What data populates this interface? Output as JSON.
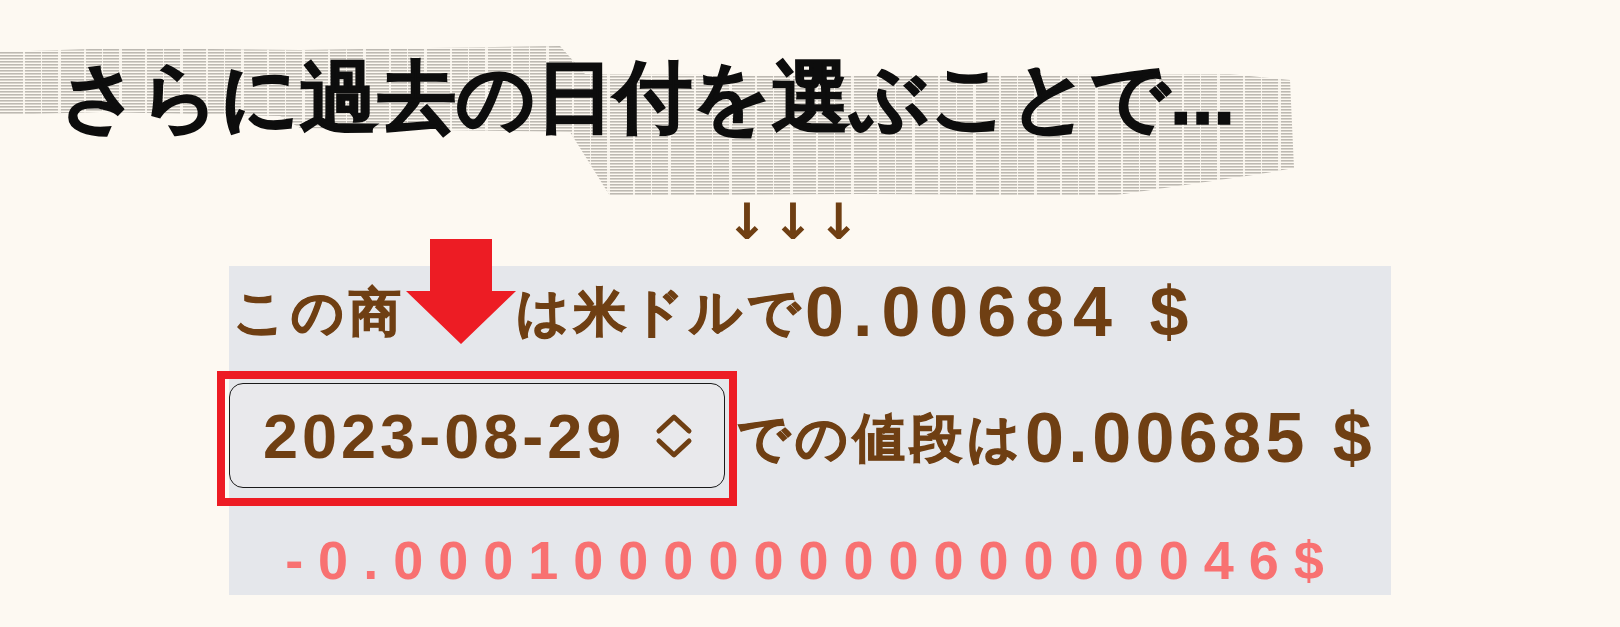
{
  "heading": {
    "text": "さらに過去の日付を選ぶことで..."
  },
  "arrows": {
    "text": "↓↓↓"
  },
  "panel": {
    "current_price": {
      "label_left": "この商",
      "label_right": "は米ドルで",
      "value": "0.00684 $",
      "arrow_marker": true
    },
    "past_price": {
      "date_select": {
        "value": "2023-08-29",
        "highlighted": true
      },
      "label": "での値段は",
      "value": "0.00685 $"
    },
    "difference": {
      "value": "-0.00010000000000000046$"
    }
  }
}
